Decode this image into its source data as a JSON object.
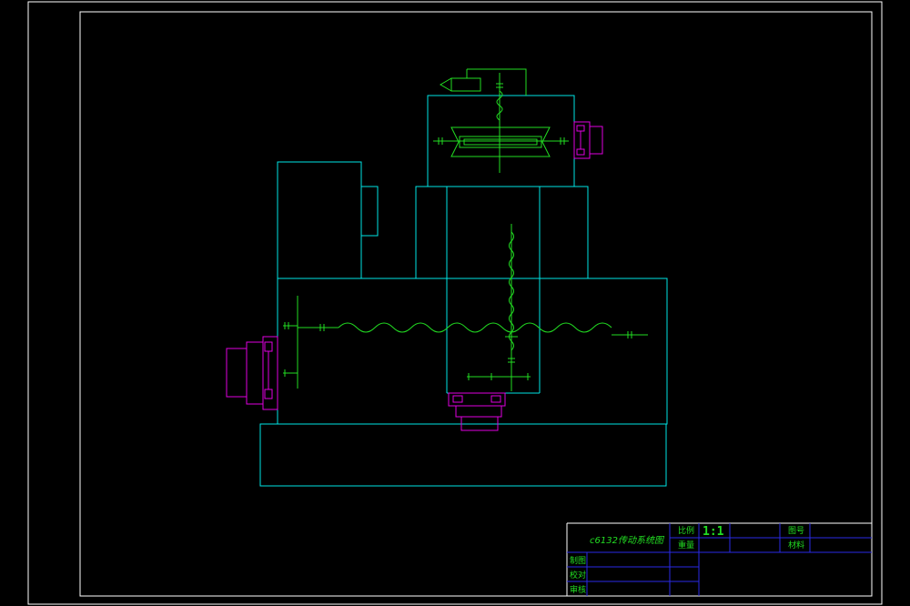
{
  "title_block": {
    "drawing_title": "c6132传动系统图",
    "scale_label": "比例",
    "scale_value": "1:1",
    "weight_label": "重量",
    "drawing_no_label": "图号",
    "material_label": "材料",
    "designer_label": "制图",
    "checker_label": "校对",
    "approver_label": "审核"
  },
  "colors": {
    "outline": "#00e5e5",
    "shaft": "#22dd22",
    "motor": "#e000e0",
    "frame": "#ffffff",
    "table_lines": "#2a2ae6"
  }
}
